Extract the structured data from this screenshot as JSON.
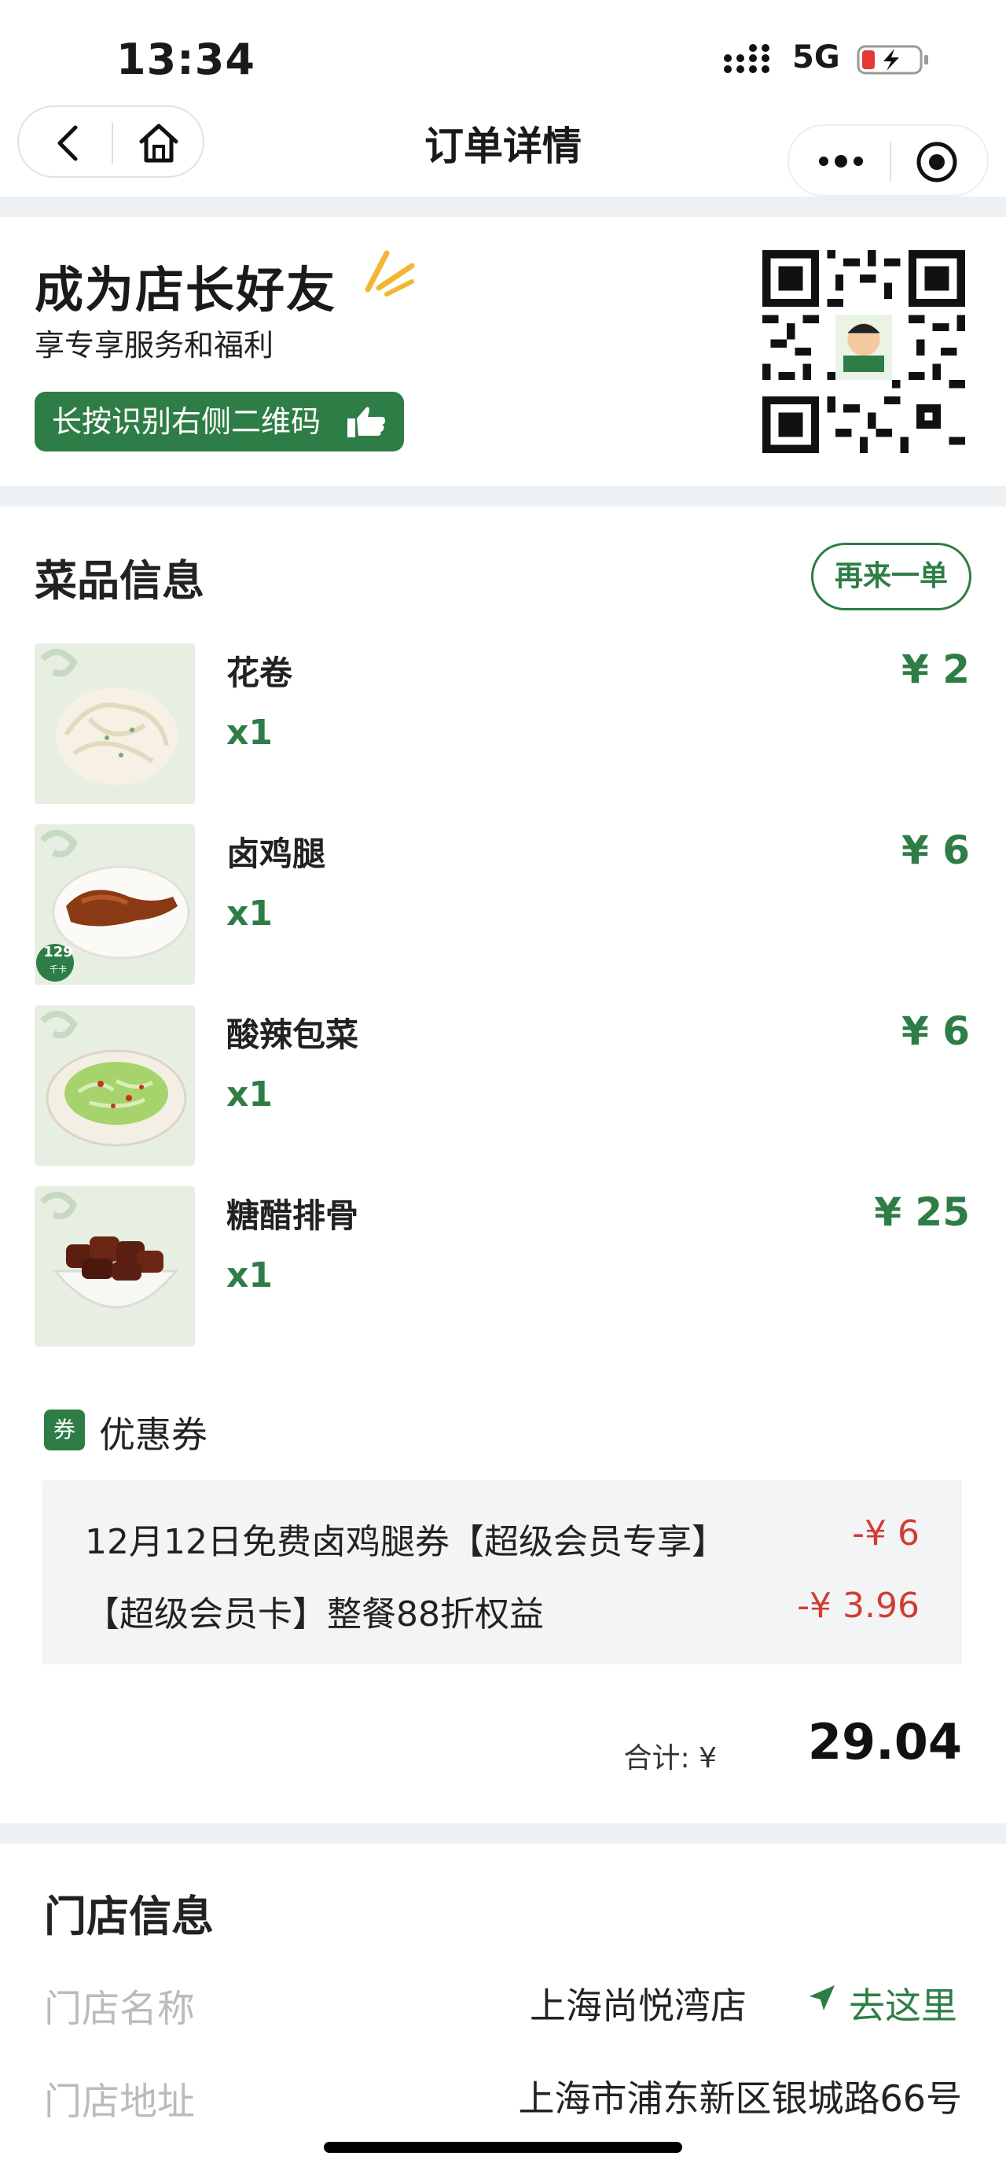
{
  "status_bar": {
    "time": "13:34",
    "network": "5G"
  },
  "nav": {
    "title": "订单详情"
  },
  "friend_banner": {
    "title": "成为店长好友",
    "subtitle": "享专享服务和福利",
    "button_label": "长按识别右侧二维码"
  },
  "menu": {
    "title": "菜品信息",
    "reorder_label": "再来一单",
    "items": [
      {
        "name": "花卷",
        "qty": "x1",
        "price": "¥ 2"
      },
      {
        "name": "卤鸡腿",
        "qty": "x1",
        "price": "¥ 6",
        "badge": "129",
        "badge_sub": "千卡"
      },
      {
        "name": "酸辣包菜",
        "qty": "x1",
        "price": "¥ 6"
      },
      {
        "name": "糖醋排骨",
        "qty": "x1",
        "price": "¥ 25"
      }
    ]
  },
  "coupon": {
    "badge": "券",
    "title": "优惠券",
    "lines": [
      {
        "text": "12月12日免费卤鸡腿券【超级会员专享】",
        "amount": "-¥ 6"
      },
      {
        "text": "【超级会员卡】整餐88折权益",
        "amount": "-¥ 3.96"
      }
    ]
  },
  "total": {
    "label": "合计: ¥",
    "value": "29.04"
  },
  "store": {
    "title": "门店信息",
    "name_label": "门店名称",
    "name_value": "上海尚悦湾店",
    "goto_label": "去这里",
    "address_label": "门店地址",
    "address_value": "上海市浦东新区银城路66号"
  },
  "colors": {
    "brand_green": "#2e7d46",
    "discount_red": "#d23c33",
    "band_gray": "#eef1f3"
  },
  "icons": [
    "back-icon",
    "home-icon",
    "more-icon",
    "target-icon",
    "thumb-icon",
    "location-arrow-icon",
    "coupon-icon"
  ]
}
